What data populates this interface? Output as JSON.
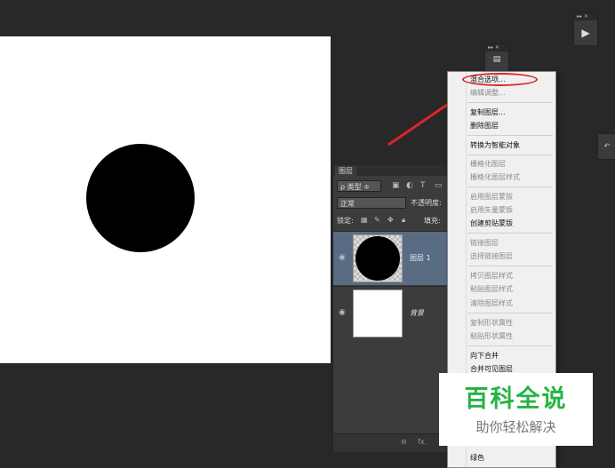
{
  "mini_panel": {
    "collapse_label": "▸▸ ✕",
    "play_icon": "play-icon"
  },
  "dock_panel": {
    "collapse_label": "▸▸ ✕",
    "icon": "properties-icon"
  },
  "side_handle": {
    "icon": "history-icon"
  },
  "layers_panel": {
    "tab_label": "图层",
    "filter_select": "ρ 类型 ≑",
    "blend_mode": "正常",
    "opacity_label": "不透明度:",
    "lock_label": "锁定:",
    "fill_label": "填充:",
    "layers": [
      {
        "name": "图层 1",
        "selected": true
      },
      {
        "name": "背景",
        "selected": false
      }
    ],
    "bottom_icons": [
      "link-icon",
      "fx-icon"
    ],
    "bottom_fx": "fx."
  },
  "context_menu": {
    "items": [
      {
        "label": "混合选项...",
        "enabled": true,
        "highlighted": true
      },
      {
        "label": "编辑调整...",
        "enabled": false
      },
      {
        "label": "复制图层...",
        "enabled": true
      },
      {
        "label": "删除图层",
        "enabled": true
      },
      {
        "label": "转换为智能对象",
        "enabled": true
      },
      {
        "label": "栅格化图层",
        "enabled": false
      },
      {
        "label": "栅格化图层样式",
        "enabled": false
      },
      {
        "label": "启用图层蒙版",
        "enabled": false
      },
      {
        "label": "启用矢量蒙版",
        "enabled": false
      },
      {
        "label": "创建剪贴蒙版",
        "enabled": true
      },
      {
        "label": "链接图层",
        "enabled": false
      },
      {
        "label": "选择链接图层",
        "enabled": false
      },
      {
        "label": "拷贝图层样式",
        "enabled": false
      },
      {
        "label": "粘贴图层样式",
        "enabled": false
      },
      {
        "label": "清除图层样式",
        "enabled": false
      },
      {
        "label": "复制形状属性",
        "enabled": false
      },
      {
        "label": "粘贴形状属性",
        "enabled": false
      },
      {
        "label": "向下合并",
        "enabled": true
      },
      {
        "label": "合并可见图层",
        "enabled": true
      },
      {
        "label": "绿色",
        "enabled": true
      }
    ]
  },
  "watermark": {
    "title": "百科全说",
    "subtitle": "助你轻松解决"
  },
  "colors": {
    "highlight_oval": "#d9262c",
    "watermark_green": "#27b344",
    "selected_layer": "#5a6b84"
  }
}
